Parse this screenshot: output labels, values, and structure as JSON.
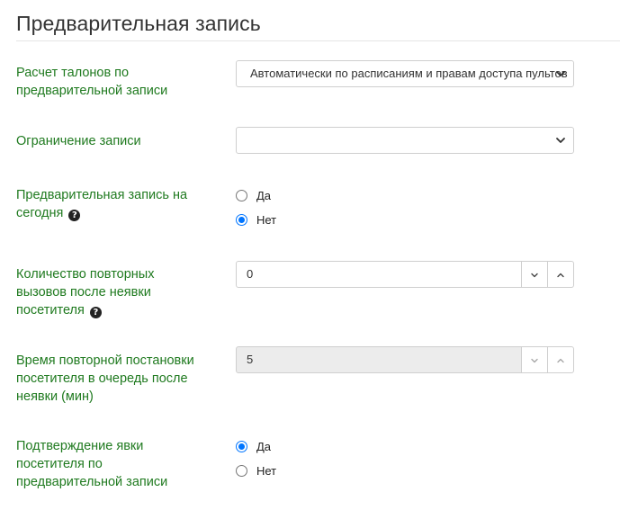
{
  "page": {
    "title": "Предварительная запись"
  },
  "fields": {
    "ticket_calc": {
      "label_lines": [
        "Расчет талонов по",
        "предварительной записи"
      ],
      "value": "Автоматически по расписаниям и правам доступа пультов"
    },
    "booking_limit": {
      "label": "Ограничение записи",
      "value": ""
    },
    "booking_today": {
      "label_lines": [
        "Предварительная запись на",
        "сегодня"
      ],
      "options": [
        {
          "label": "Да",
          "checked": false
        },
        {
          "label": "Нет",
          "checked": true
        }
      ]
    },
    "recall_count": {
      "label_lines": [
        "Количество повторных",
        "вызовов после неявки",
        "посетителя"
      ],
      "value": "0"
    },
    "requeue_time": {
      "label_lines": [
        "Время повторной постановки",
        "посетителя в очередь после",
        "неявки (мин)"
      ],
      "value": "5"
    },
    "visit_confirm": {
      "label_lines": [
        "Подтверждение явки",
        "посетителя по",
        "предварительной записи"
      ],
      "options": [
        {
          "label": "Да",
          "checked": true
        },
        {
          "label": "Нет",
          "checked": false
        }
      ]
    }
  },
  "icons": {
    "help": "question-circle-icon",
    "chevron": "chevron-down-icon"
  },
  "colors": {
    "label": "#1f7a1f",
    "radio_checked": "#0075ff"
  }
}
